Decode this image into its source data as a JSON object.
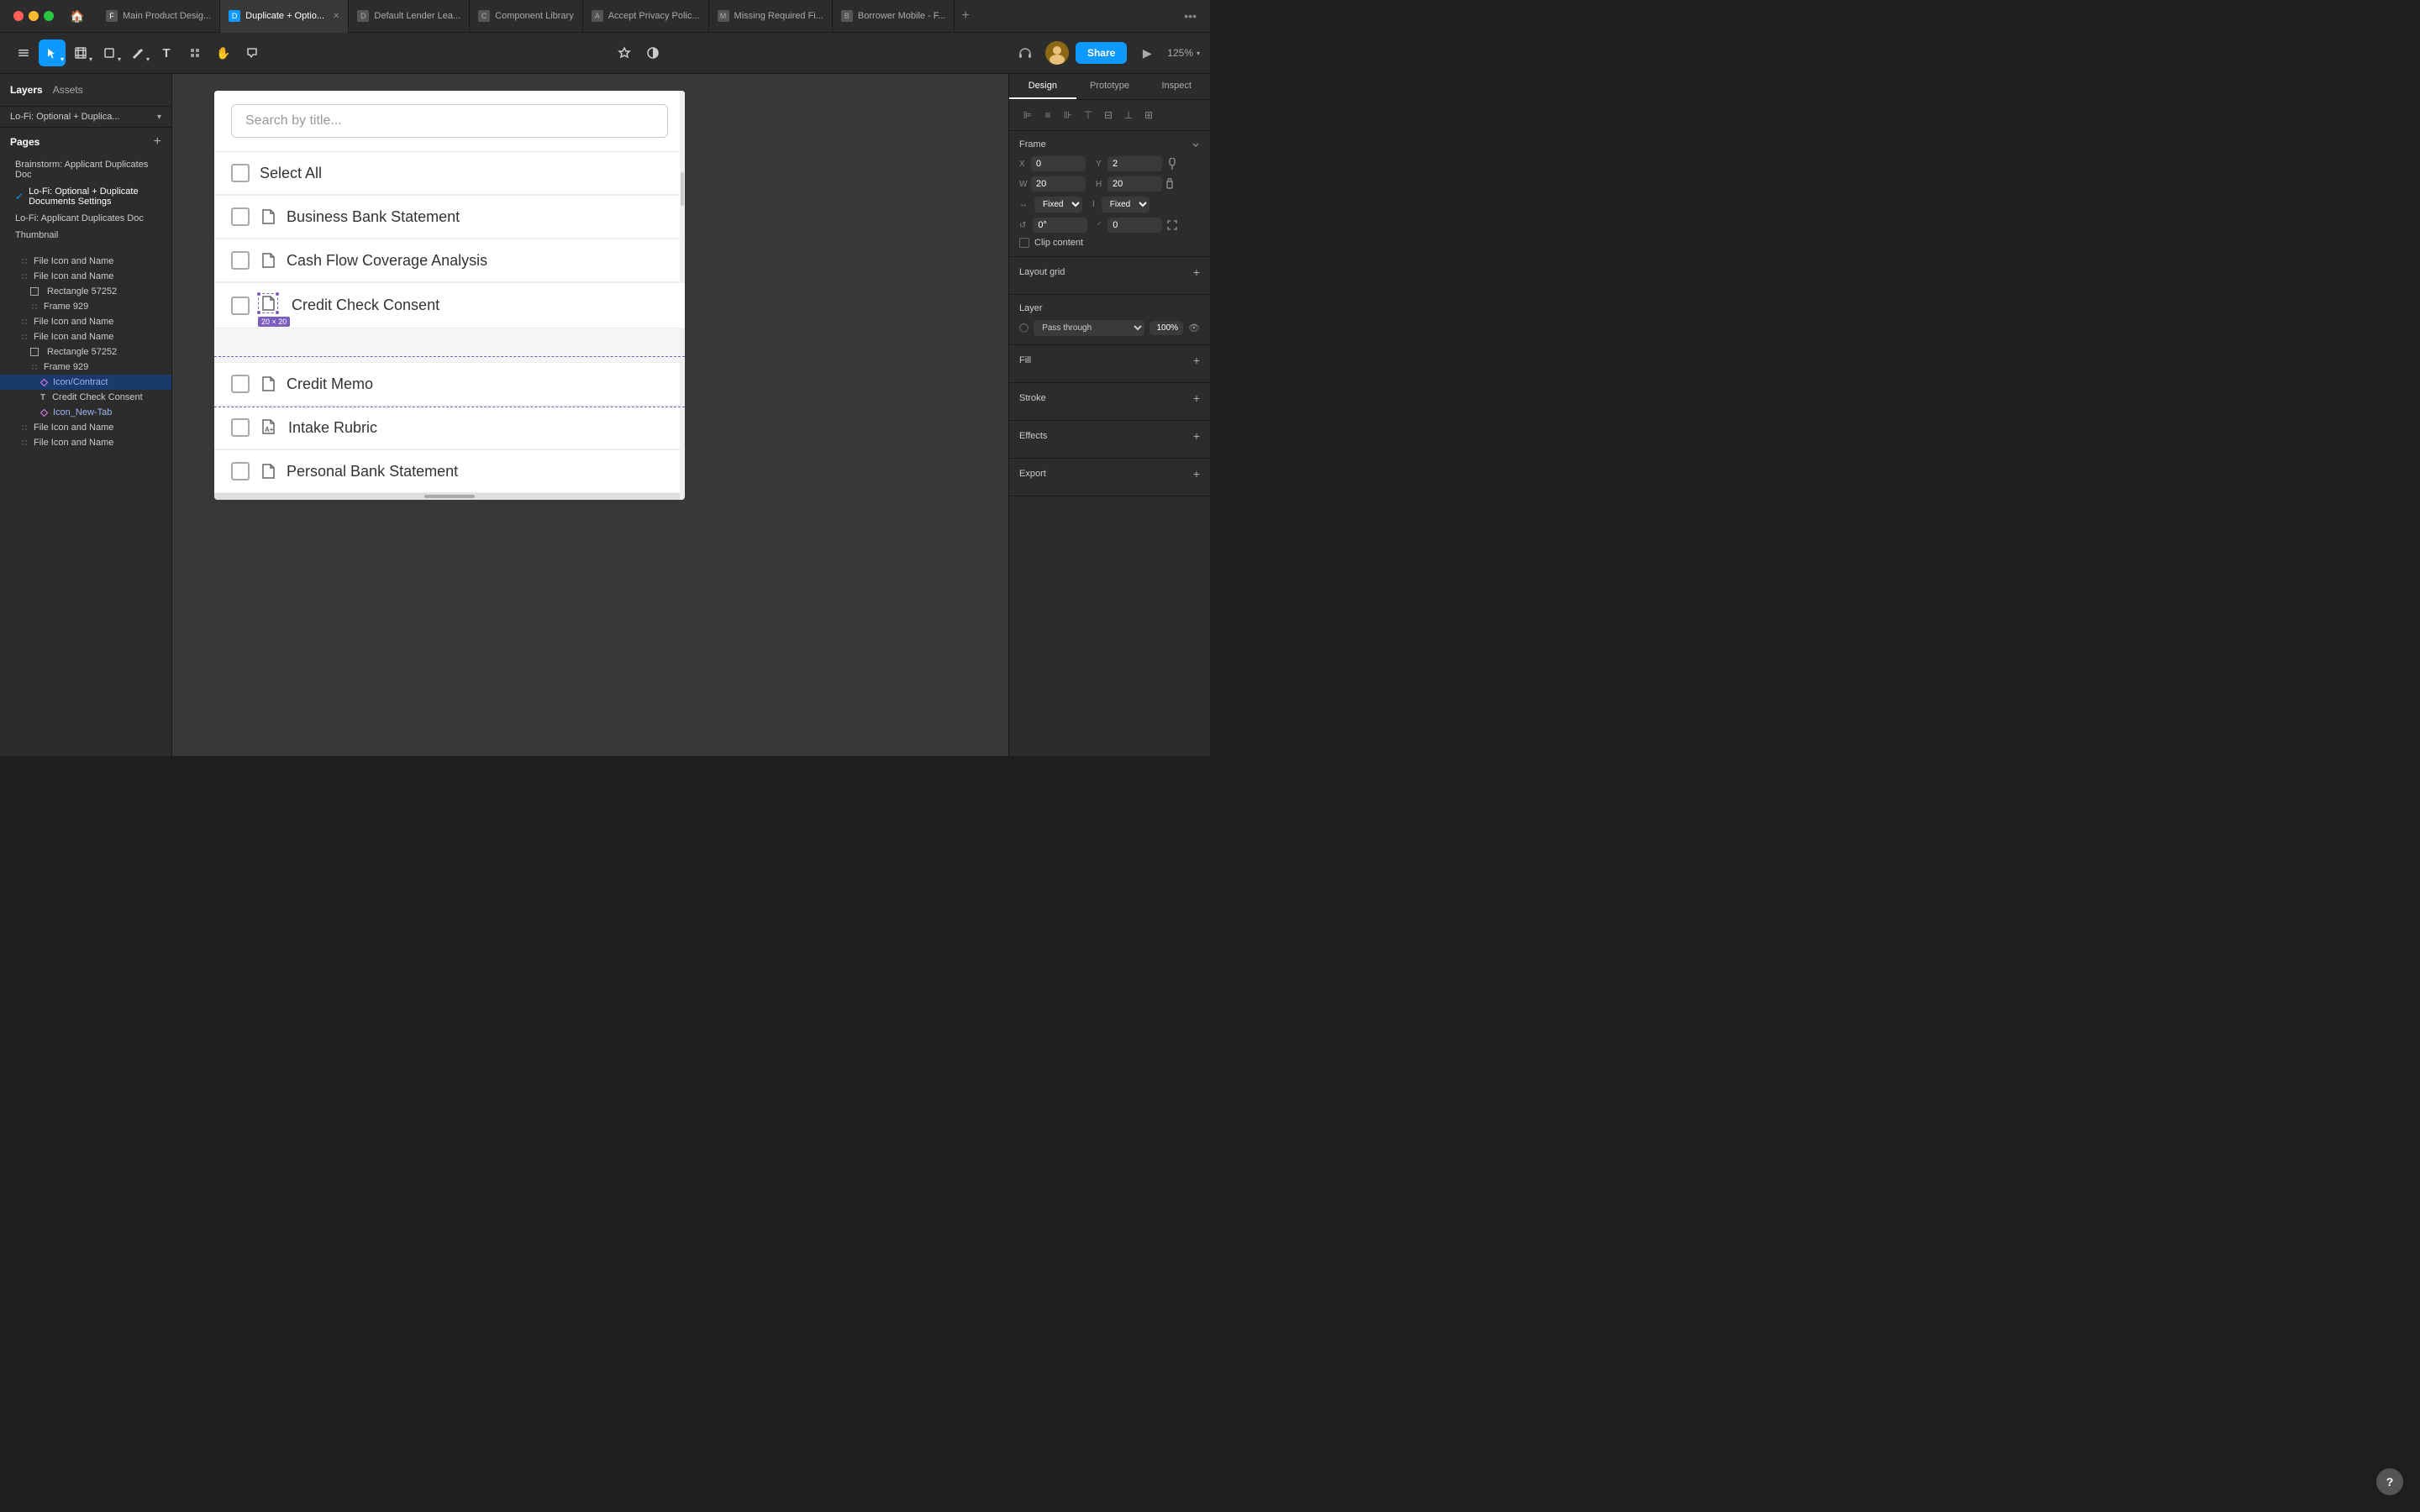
{
  "topbar": {
    "tabs": [
      {
        "id": "tab-main",
        "label": "Main Product Desig...",
        "favicon_color": "#888",
        "active": false
      },
      {
        "id": "tab-duplicate",
        "label": "Duplicate + Optio...",
        "favicon_color": "#0d99ff",
        "active": true,
        "closable": true
      },
      {
        "id": "tab-default",
        "label": "Default Lender Lea...",
        "favicon_color": "#888",
        "active": false
      },
      {
        "id": "tab-component",
        "label": "Component Library",
        "favicon_color": "#888",
        "active": false
      },
      {
        "id": "tab-accept",
        "label": "Accept Privacy Polic...",
        "favicon_color": "#888",
        "active": false
      },
      {
        "id": "tab-missing",
        "label": "Missing Required Fi...",
        "favicon_color": "#888",
        "active": false
      },
      {
        "id": "tab-borrower",
        "label": "Borrower Mobile - F...",
        "favicon_color": "#888",
        "active": false
      }
    ]
  },
  "toolbar": {
    "tools": [
      {
        "id": "menu",
        "icon": "⊞",
        "active": false
      },
      {
        "id": "cursor",
        "icon": "↖",
        "active": true,
        "has_chevron": true
      },
      {
        "id": "frame",
        "icon": "⊡",
        "active": false,
        "has_chevron": true
      },
      {
        "id": "shape",
        "icon": "□",
        "active": false,
        "has_chevron": true
      },
      {
        "id": "pen",
        "icon": "✒",
        "active": false,
        "has_chevron": true
      },
      {
        "id": "text",
        "icon": "T",
        "active": false
      },
      {
        "id": "component",
        "icon": "⧉",
        "active": false
      },
      {
        "id": "hand",
        "icon": "✋",
        "active": false
      },
      {
        "id": "comment",
        "icon": "💬",
        "active": false
      }
    ],
    "center_tools": [
      {
        "id": "plugin",
        "icon": "✦"
      },
      {
        "id": "theme",
        "icon": "◑"
      }
    ],
    "right": {
      "present_label": "▶",
      "share_label": "Share",
      "zoom_label": "125%"
    }
  },
  "left_panel": {
    "tabs": [
      {
        "id": "layers-tab",
        "label": "Layers",
        "active": true
      },
      {
        "id": "assets-tab",
        "label": "Assets",
        "active": false
      }
    ],
    "breadcrumb": "Lo-Fi: Optional + Duplica...",
    "pages": [
      {
        "id": "page-brainstorm",
        "label": "Brainstorm: Applicant Duplicates Doc",
        "active": false
      },
      {
        "id": "page-lofi-optional",
        "label": "Lo-Fi: Optional + Duplicate Documents Settings",
        "active": true
      },
      {
        "id": "page-lofi-applicant",
        "label": "Lo-Fi: Applicant Duplicates Doc",
        "active": false
      },
      {
        "id": "page-thumbnail",
        "label": "Thumbnail",
        "active": false
      }
    ],
    "layers": [
      {
        "id": "layer-1",
        "label": "File Icon and Name",
        "indent": 1,
        "icon": "drag",
        "active": false
      },
      {
        "id": "layer-2",
        "label": "File Icon and Name",
        "indent": 1,
        "icon": "drag",
        "active": false
      },
      {
        "id": "layer-3",
        "label": "Rectangle 57252",
        "indent": 2,
        "icon": "rect",
        "active": false
      },
      {
        "id": "layer-4",
        "label": "Frame 929",
        "indent": 2,
        "icon": "drag",
        "active": false
      },
      {
        "id": "layer-5",
        "label": "File Icon and Name",
        "indent": 1,
        "icon": "drag",
        "active": false
      },
      {
        "id": "layer-6",
        "label": "File Icon and Name",
        "indent": 1,
        "icon": "drag",
        "active": false
      },
      {
        "id": "layer-7",
        "label": "Rectangle 57252",
        "indent": 2,
        "icon": "rect",
        "active": false
      },
      {
        "id": "layer-8",
        "label": "Frame 929",
        "indent": 2,
        "icon": "drag",
        "active": false
      },
      {
        "id": "layer-9",
        "label": "Icon/Contract",
        "indent": 3,
        "icon": "diamond",
        "active": true
      },
      {
        "id": "layer-10",
        "label": "Credit Check Consent",
        "indent": 3,
        "icon": "text",
        "active": false
      },
      {
        "id": "layer-11",
        "label": "Icon_New-Tab",
        "indent": 3,
        "icon": "diamond",
        "active": false
      },
      {
        "id": "layer-12",
        "label": "File Icon and Name",
        "indent": 1,
        "icon": "drag",
        "active": false
      },
      {
        "id": "layer-13",
        "label": "File Icon and Name",
        "indent": 1,
        "icon": "drag",
        "active": false
      }
    ]
  },
  "canvas": {
    "search_placeholder": "Search by title...",
    "select_all_label": "Select All",
    "documents": [
      {
        "id": "doc-bank-statement",
        "label": "Business Bank Statement",
        "icon": "file"
      },
      {
        "id": "doc-cash-flow",
        "label": "Cash Flow Coverage Analysis",
        "icon": "file"
      },
      {
        "id": "doc-credit-check",
        "label": "Credit Check Consent",
        "icon": "file",
        "selected": true
      },
      {
        "id": "doc-credit-memo",
        "label": "Credit Memo",
        "icon": "file"
      },
      {
        "id": "doc-intake-rubric",
        "label": "Intake Rubric",
        "icon": "file-plus"
      },
      {
        "id": "doc-personal-bank",
        "label": "Personal Bank Statement",
        "icon": "file"
      }
    ],
    "selection": {
      "size_label": "20 × 20",
      "color": "#7c5cbf"
    }
  },
  "right_panel": {
    "tabs": [
      {
        "id": "design-tab",
        "label": "Design",
        "active": true
      },
      {
        "id": "prototype-tab",
        "label": "Prototype",
        "active": false
      },
      {
        "id": "inspect-tab",
        "label": "Inspect",
        "active": false
      }
    ],
    "frame_section": {
      "title": "Frame",
      "x": "0",
      "y": "2",
      "w": "20",
      "h": "20",
      "rotation": "0°",
      "corner_radius": "0",
      "fixed_w": "Fixed",
      "fixed_h": "Fixed"
    },
    "clip_content": false,
    "layout_grid": {
      "title": "Layout grid"
    },
    "layer_section": {
      "title": "Layer",
      "blend_mode": "Pass through",
      "opacity": "100%"
    },
    "fill_section": {
      "title": "Fill"
    },
    "stroke_section": {
      "title": "Stroke"
    },
    "effects_section": {
      "title": "Effects"
    },
    "export_section": {
      "title": "Export"
    }
  },
  "help": {
    "label": "?"
  }
}
